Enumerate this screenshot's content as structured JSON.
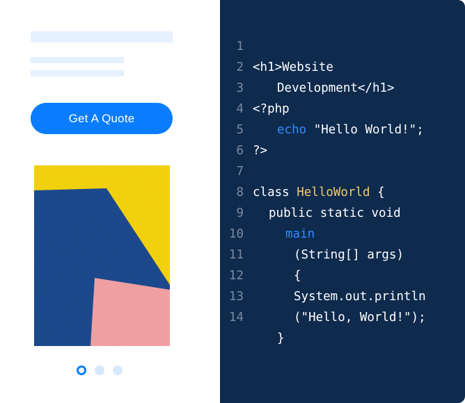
{
  "colors": {
    "accent": "#0a7cff",
    "skeleton": "#e6f1fd",
    "code_background": "#0e2a4d",
    "line_number": "#7a8aa1",
    "keyword_blue": "#2f8cff",
    "keyword_yellow": "#f5c96b",
    "image_yellow": "#f6d40e",
    "image_blue": "#1c4a8f",
    "image_pink": "#f4a3a6"
  },
  "website_preview": {
    "cta_label": "Get A Quote",
    "image_icon": "abstract-art-image",
    "carousel": {
      "slide_count": 3,
      "active_index": 0
    }
  },
  "code_editor": {
    "lines": [
      {
        "number": "1",
        "text": "<h1>Website"
      },
      {
        "number": "2",
        "text": "Development</h1>"
      },
      {
        "number": "3",
        "text": "<?php"
      },
      {
        "number": "4",
        "keyword": "echo",
        "text": " \"Hello World!\";"
      },
      {
        "number": "5",
        "text": "?>"
      },
      {
        "number": "6",
        "text": ""
      },
      {
        "number": "7",
        "prefix": "class ",
        "class_name": "HelloWorld",
        "suffix": " {"
      },
      {
        "number": "8",
        "text": "public static void"
      },
      {
        "number": "9",
        "keyword": "main"
      },
      {
        "number": "10",
        "text": "(String[] args)"
      },
      {
        "number": "11",
        "text": "{"
      },
      {
        "number": "12",
        "text": "System.out.println"
      },
      {
        "number": "13",
        "text": "(\"Hello, World!\");"
      },
      {
        "number": "14",
        "text": "}"
      }
    ]
  }
}
